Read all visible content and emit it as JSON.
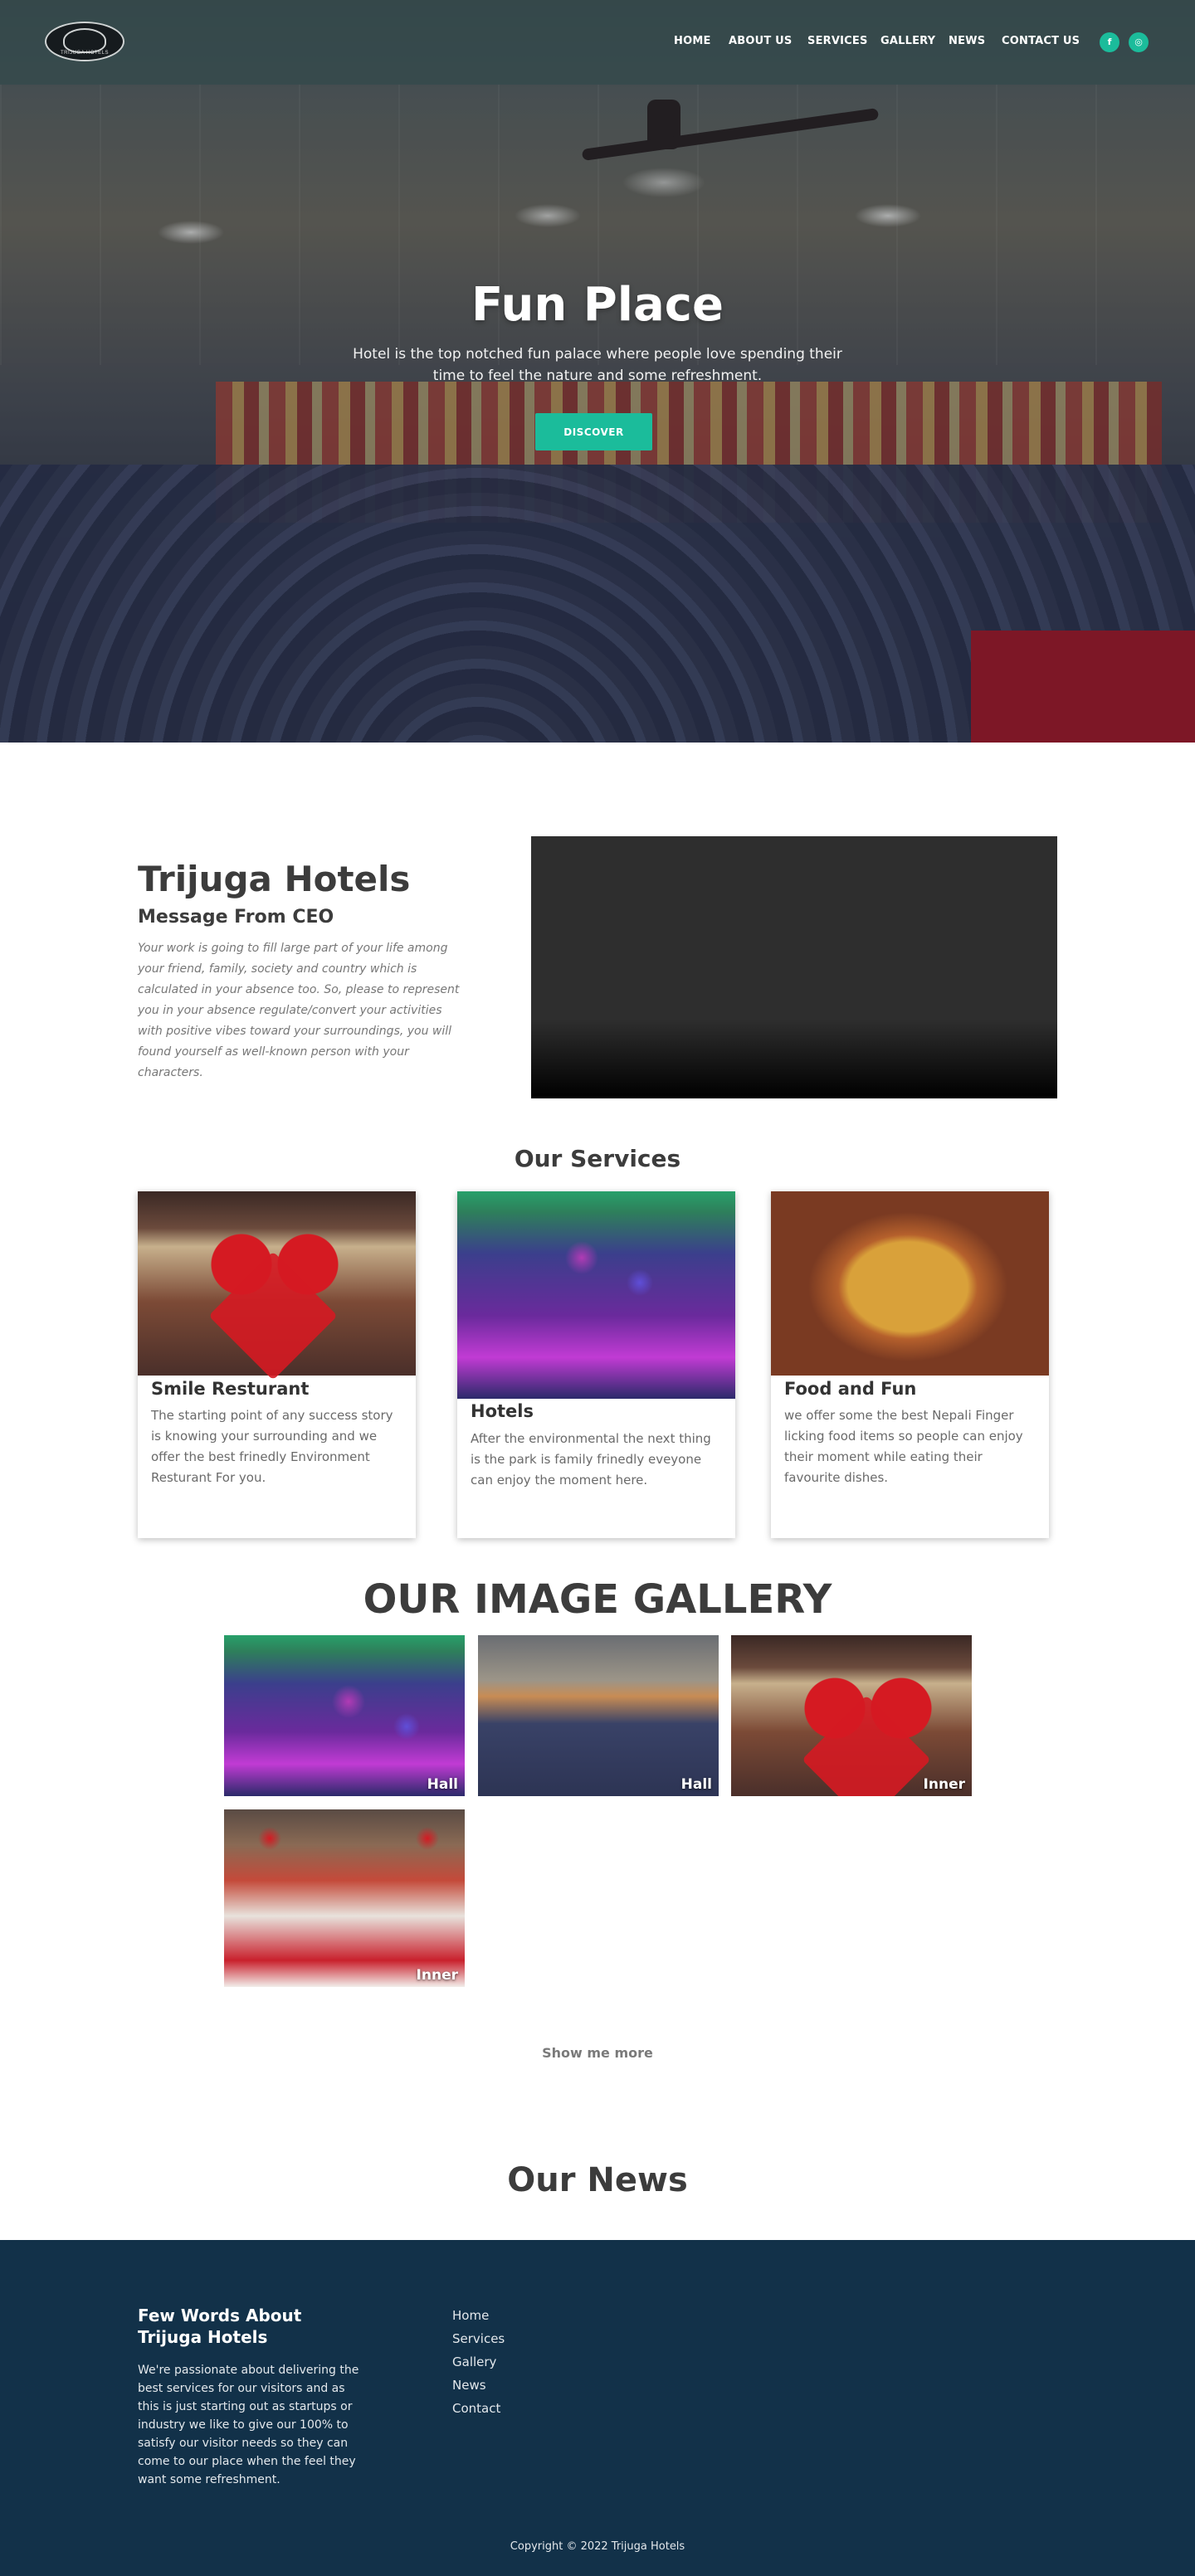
{
  "nav": {
    "logo_text": "TRIJUGA HOTELS",
    "items": [
      "HOME",
      "ABOUT US",
      "SERVICES",
      "GALLERY",
      "NEWS",
      "CONTACT US"
    ],
    "social": [
      "f",
      "◎"
    ]
  },
  "hero": {
    "title": "Fun Place",
    "subtitle": "Hotel is the top notched fun palace where people love spending their time to feel the nature and some refreshment.",
    "button": "DISCOVER"
  },
  "about": {
    "title": "Trijuga Hotels",
    "subtitle": "Message From CEO",
    "text": "Your work is going to fill large part of your life among your friend, family, society and country which is calculated in your absence too. So, please to represent you in your absence regulate/convert your activities with positive vibes toward your surroundings, you will found yourself as well-known person with your characters."
  },
  "services": {
    "heading": "Our Services",
    "cards": [
      {
        "title": "Smile Resturant",
        "text": "The starting point of any success story is knowing your surrounding and we offer the best frinedly Environment Resturant For you."
      },
      {
        "title": "Hotels",
        "text": "After the environmental the next thing is the park is family frinedly eveyone can enjoy the moment here."
      },
      {
        "title": "Food and Fun",
        "text": "we offer some the best Nepali Finger licking food items so people can enjoy their moment while eating their favourite dishes."
      }
    ]
  },
  "gallery": {
    "heading": "OUR IMAGE GALLERY",
    "items": [
      {
        "caption": "Hall"
      },
      {
        "caption": "Hall"
      },
      {
        "caption": "Inner"
      },
      {
        "caption": "Inner"
      }
    ],
    "show_more": "Show me more"
  },
  "news": {
    "heading": "Our News"
  },
  "footer": {
    "title": "Few Words About Trijuga Hotels",
    "text": "We're passionate about delivering the best services for our visitors and as this is just starting out as startups or industry we like to give our 100% to satisfy our visitor needs so they can come to our place when the feel they want some refreshment.",
    "links": [
      "Home",
      "Services",
      "Gallery",
      "News",
      "Contact"
    ],
    "copyright": "Copyright © 2022 Trijuga Hotels"
  },
  "colors": {
    "accent": "#1bbc9b",
    "footer_bg": "#123149",
    "heading": "#3c3c3c"
  }
}
